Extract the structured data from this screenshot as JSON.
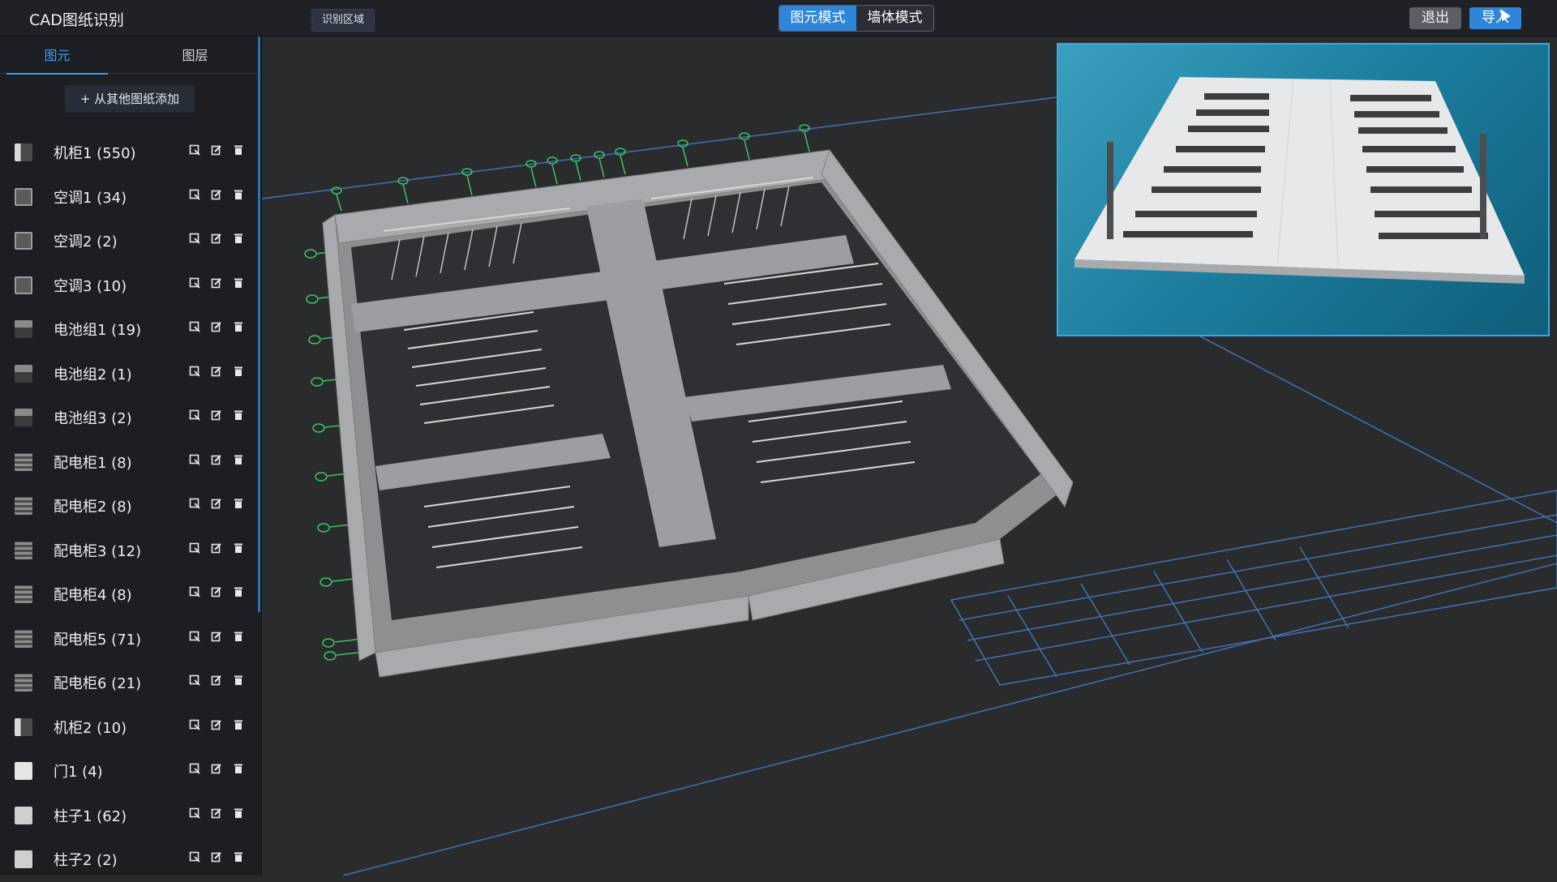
{
  "app": {
    "title": "CAD图纸识别"
  },
  "toolbar": {
    "region_label": "识别区域",
    "modes": [
      {
        "label": "图元模式",
        "active": true
      },
      {
        "label": "墙体模式",
        "active": false
      }
    ],
    "exit_label": "退出",
    "import_label": "导入"
  },
  "sidebar": {
    "tabs": [
      {
        "label": "图元",
        "active": true
      },
      {
        "label": "图层",
        "active": false
      }
    ],
    "add_label": "+ 从其他图纸添加",
    "items": [
      {
        "label": "机柜1 (550)",
        "icon": "cabinet-icon"
      },
      {
        "label": "空调1 (34)",
        "icon": "air-conditioner-icon"
      },
      {
        "label": "空调2 (2)",
        "icon": "air-conditioner-icon"
      },
      {
        "label": "空调3 (10)",
        "icon": "air-conditioner-icon"
      },
      {
        "label": "电池组1 (19)",
        "icon": "battery-icon"
      },
      {
        "label": "电池组2 (1)",
        "icon": "battery-icon"
      },
      {
        "label": "电池组3 (2)",
        "icon": "battery-icon"
      },
      {
        "label": "配电柜1 (8)",
        "icon": "power-cabinet-icon"
      },
      {
        "label": "配电柜2 (8)",
        "icon": "power-cabinet-icon"
      },
      {
        "label": "配电柜3 (12)",
        "icon": "power-cabinet-icon"
      },
      {
        "label": "配电柜4 (8)",
        "icon": "power-cabinet-icon"
      },
      {
        "label": "配电柜5 (71)",
        "icon": "power-cabinet-icon"
      },
      {
        "label": "配电柜6 (21)",
        "icon": "power-cabinet-icon"
      },
      {
        "label": "机柜2 (10)",
        "icon": "cabinet-icon"
      },
      {
        "label": "门1 (4)",
        "icon": "door-icon"
      },
      {
        "label": "柱子1 (62)",
        "icon": "column-icon"
      },
      {
        "label": "柱子2 (2)",
        "icon": "column-icon"
      }
    ],
    "item_actions": [
      "locate-icon",
      "edit-icon",
      "delete-icon"
    ]
  },
  "colors": {
    "accent": "#2f86d8",
    "preview_border": "#3aa7e6",
    "axis_green": "#3cc46a",
    "grid_blue": "#4a7fc9"
  }
}
